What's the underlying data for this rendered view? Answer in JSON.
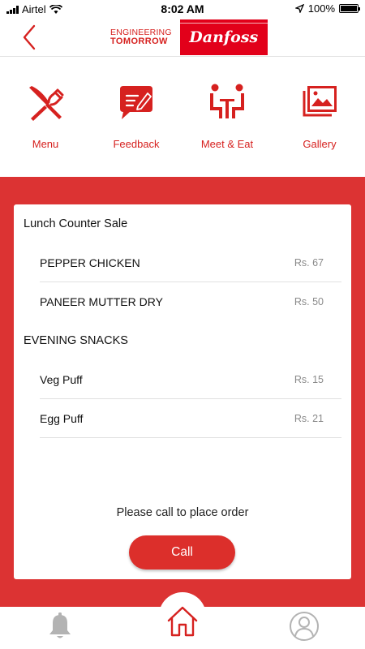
{
  "status_bar": {
    "carrier": "Airtel",
    "time": "8:02 AM",
    "battery": "100%"
  },
  "header": {
    "tagline_line1": "ENGINEERING",
    "tagline_line2": "TOMORROW",
    "brand_logo": "Danfoss"
  },
  "nav": {
    "items": [
      {
        "label": "Menu",
        "icon": "fork-knife-icon"
      },
      {
        "label": "Feedback",
        "icon": "feedback-icon"
      },
      {
        "label": "Meet & Eat",
        "icon": "meet-eat-icon"
      },
      {
        "label": "Gallery",
        "icon": "gallery-icon"
      }
    ]
  },
  "menu": {
    "sections": [
      {
        "title": "Lunch Counter Sale",
        "items": [
          {
            "name": "PEPPER CHICKEN",
            "price": "Rs. 67"
          },
          {
            "name": "PANEER MUTTER DRY",
            "price": "Rs. 50"
          }
        ]
      },
      {
        "title": "EVENING SNACKS",
        "items": [
          {
            "name": "Veg Puff",
            "price": "Rs. 15"
          },
          {
            "name": "Egg Puff",
            "price": "Rs. 21"
          }
        ]
      }
    ],
    "order_note": "Please call to place order",
    "call_label": "Call"
  },
  "tabs": [
    {
      "icon": "bell-icon"
    },
    {
      "icon": "home-icon"
    },
    {
      "icon": "profile-icon"
    }
  ],
  "colors": {
    "accent": "#d6211f",
    "content_background": "#dc3333",
    "button": "#dc2f2b"
  }
}
